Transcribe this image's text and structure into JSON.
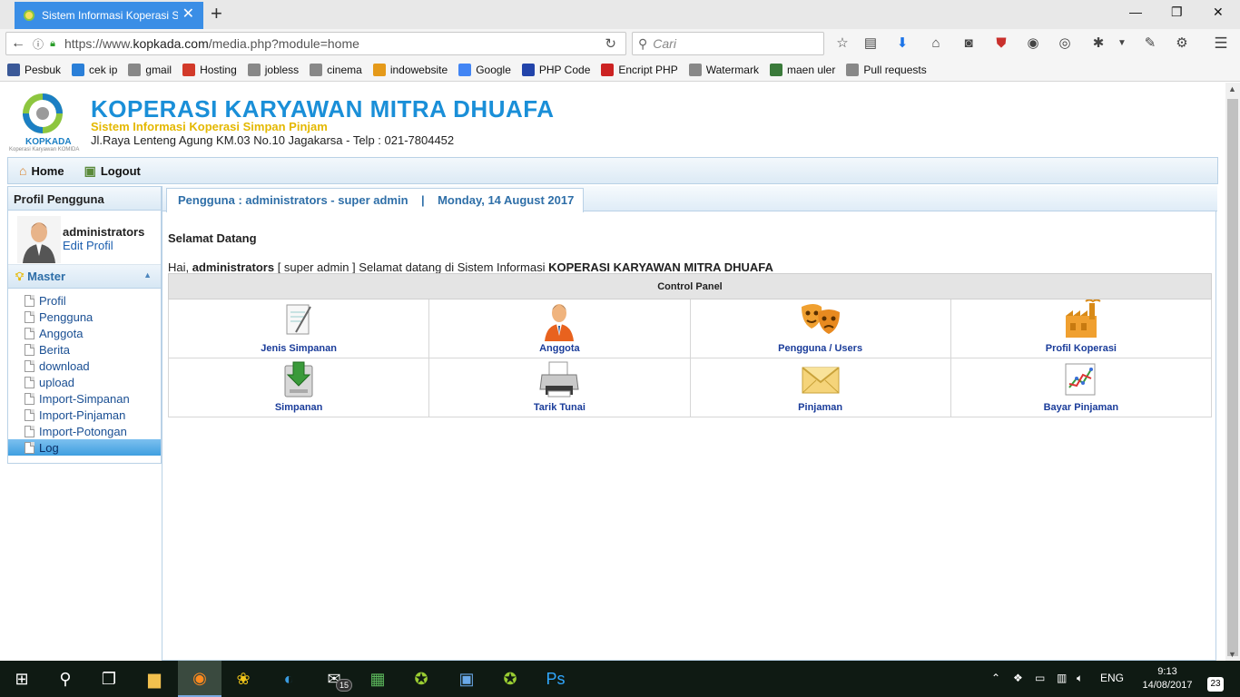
{
  "browser": {
    "tab_title": "Sistem Informasi Koperasi Si",
    "url_prefix": "https://www.",
    "url_domain": "kopkada.com",
    "url_path": "/media.php?module=home",
    "search_placeholder": "Cari"
  },
  "bookmarks": [
    {
      "label": "Pesbuk",
      "color": "#3b5998"
    },
    {
      "label": "cek ip",
      "color": "#2a7fd8"
    },
    {
      "label": "gmail",
      "color": "#888888"
    },
    {
      "label": "Hosting",
      "color": "#d23a2a"
    },
    {
      "label": "jobless",
      "color": "#888888"
    },
    {
      "label": "cinema",
      "color": "#888888"
    },
    {
      "label": "indowebsite",
      "color": "#e59a1a"
    },
    {
      "label": "Google",
      "color": "#4285f4"
    },
    {
      "label": "PHP Code",
      "color": "#2244aa"
    },
    {
      "label": "Encript PHP",
      "color": "#cc2222"
    },
    {
      "label": "Watermark",
      "color": "#888888"
    },
    {
      "label": "maen uler",
      "color": "#3a7a3a"
    },
    {
      "label": "Pull requests",
      "color": "#888888"
    }
  ],
  "site": {
    "title": "KOPERASI KARYAWAN MITRA DHUAFA",
    "subtitle": "Sistem Informasi Koperasi Simpan Pinjam",
    "address": "Jl.Raya Lenteng Agung KM.03 No.10 Jagakarsa - Telp : 021-7804452",
    "logo_text": "KOPKADA",
    "logo_sub": "Koperasi Karyawan KOMIDA"
  },
  "menu": {
    "home": "Home",
    "logout": "Logout"
  },
  "sidebar": {
    "heading": "Profil Pengguna",
    "user_name": "administrators",
    "edit_profile": "Edit Profil",
    "section": "Master",
    "items": [
      "Profil",
      "Pengguna",
      "Anggota",
      "Berita",
      "download",
      "upload",
      "Import-Simpanan",
      "Import-Pinjaman",
      "Import-Potongan",
      "Log"
    ],
    "active_index": 9
  },
  "content": {
    "tab_label": "Pengguna : administrators - super admin    |    Monday, 14 August 2017",
    "welcome_title": "Selamat Datang",
    "greeting_prefix": "Hai,",
    "greeting_user": "administrators",
    "greeting_mid": "[ super admin ] Selamat datang di Sistem Informasi",
    "greeting_org": "KOPERASI KARYAWAN MITRA DHUAFA",
    "panel_title": "Control Panel",
    "panel_items": [
      {
        "label": "Jenis Simpanan",
        "icon": "document-pen-icon"
      },
      {
        "label": "Anggota",
        "icon": "user-icon"
      },
      {
        "label": "Pengguna / Users",
        "icon": "masks-icon"
      },
      {
        "label": "Profil Koperasi",
        "icon": "factory-icon"
      },
      {
        "label": "Simpanan",
        "icon": "download-icon"
      },
      {
        "label": "Tarik Tunai",
        "icon": "printer-icon"
      },
      {
        "label": "Pinjaman",
        "icon": "envelope-icon"
      },
      {
        "label": "Bayar Pinjaman",
        "icon": "chart-icon"
      }
    ]
  },
  "taskbar": {
    "mail_badge": "15",
    "language": "ENG",
    "time": "9:13",
    "date": "14/08/2017",
    "notifications": "23"
  }
}
